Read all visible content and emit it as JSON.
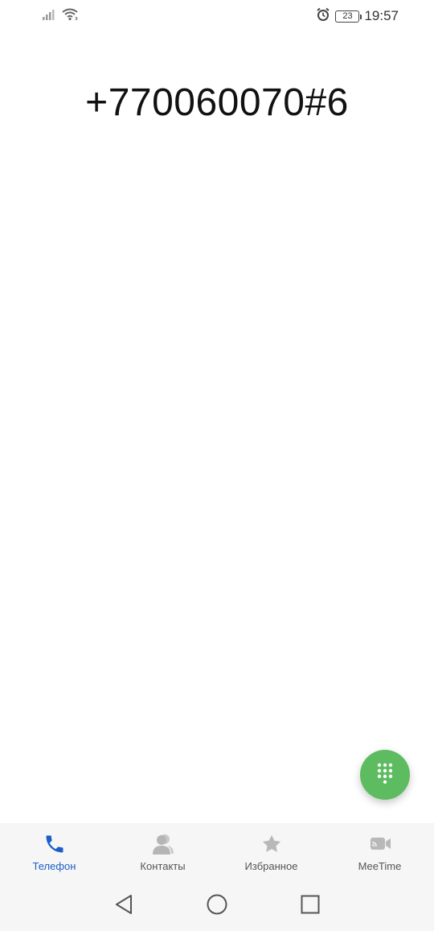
{
  "status_bar": {
    "time": "19:57",
    "battery_level": "23",
    "icons": [
      "signal-icon",
      "wifi-icon",
      "alarm-icon",
      "battery-icon"
    ]
  },
  "dialer": {
    "number": "+770060070#6"
  },
  "fab": {
    "icon": "dialpad-icon",
    "color": "#5cbc5f"
  },
  "tabs": [
    {
      "label": "Телефон",
      "icon": "phone-icon",
      "active": true
    },
    {
      "label": "Контакты",
      "icon": "contacts-icon",
      "active": false
    },
    {
      "label": "Избранное",
      "icon": "star-icon",
      "active": false
    },
    {
      "label": "MeeTime",
      "icon": "video-call-icon",
      "active": false
    }
  ],
  "nav": {
    "buttons": [
      "back-icon",
      "home-icon",
      "recents-icon"
    ]
  },
  "colors": {
    "accent": "#1b5fc8",
    "inactive_icon": "#b8b8b8"
  }
}
